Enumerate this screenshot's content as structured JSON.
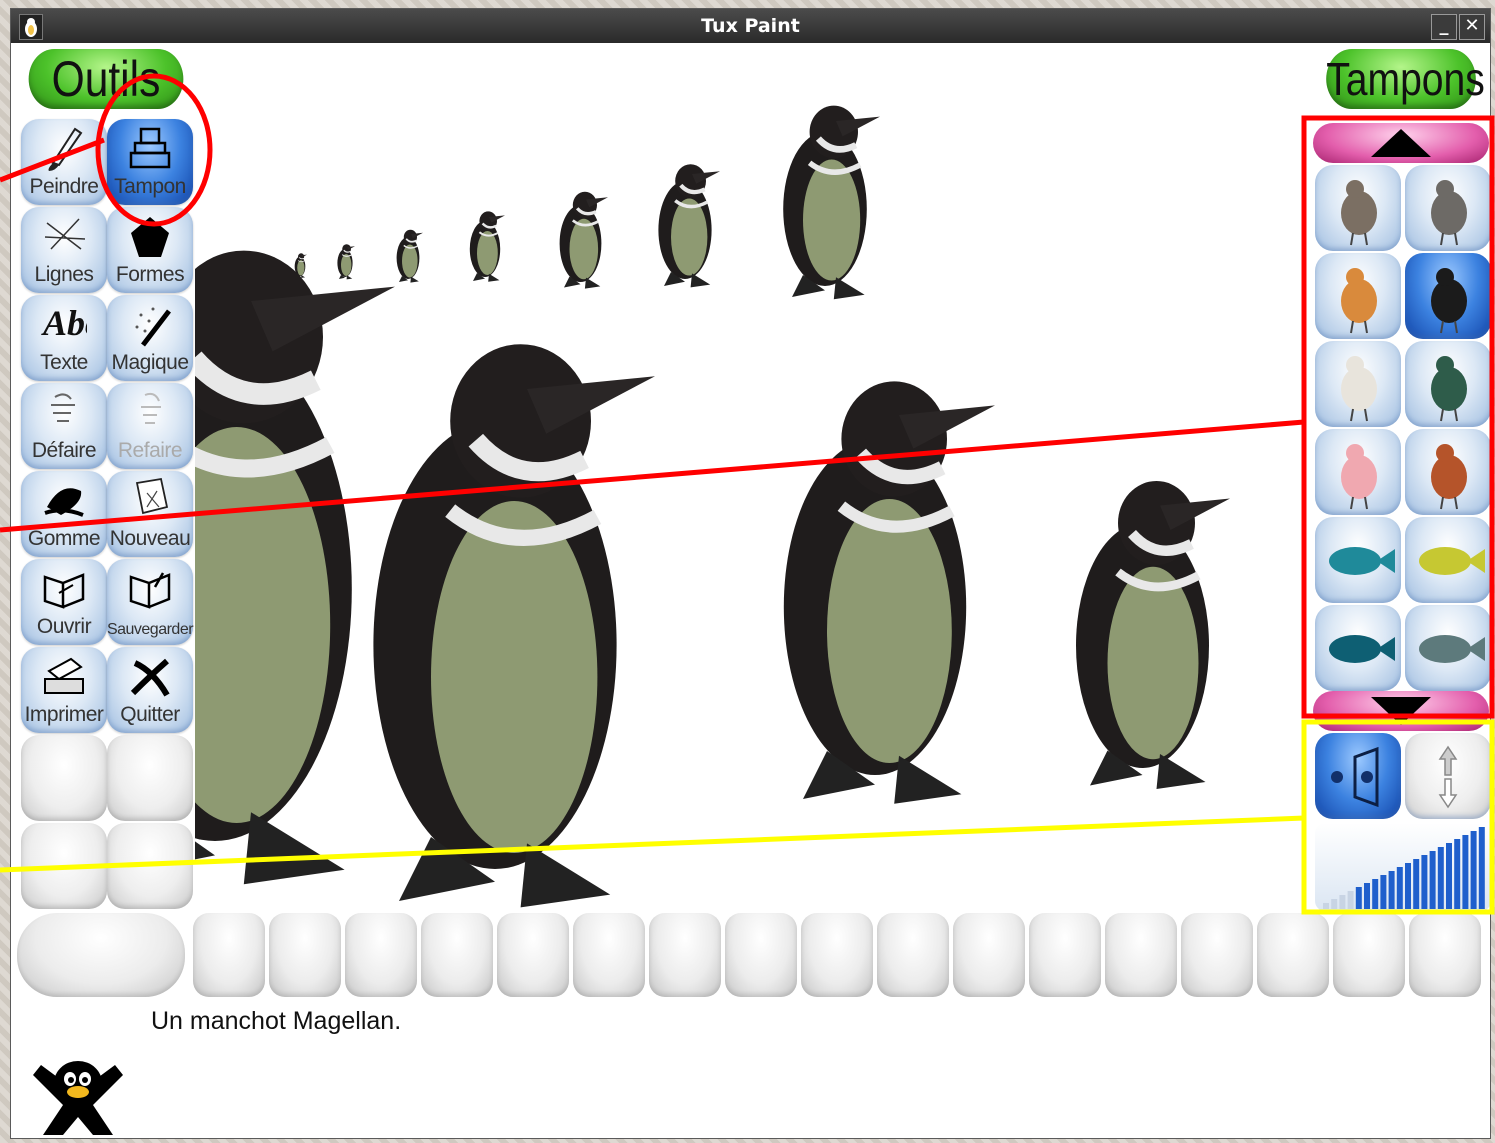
{
  "window": {
    "title": "Tux Paint",
    "minimize_symbol": "_",
    "close_symbol": "✕"
  },
  "tools_panel": {
    "header": "Outils",
    "items": [
      {
        "label": "Peindre",
        "icon": "brush-icon",
        "selected": false,
        "disabled": false
      },
      {
        "label": "Tampon",
        "icon": "stamp-icon",
        "selected": true,
        "disabled": false
      },
      {
        "label": "Lignes",
        "icon": "lines-icon",
        "selected": false,
        "disabled": false
      },
      {
        "label": "Formes",
        "icon": "shapes-icon",
        "selected": false,
        "disabled": false
      },
      {
        "label": "Texte",
        "icon": "text-icon",
        "icon_text": "Abc",
        "selected": false,
        "disabled": false
      },
      {
        "label": "Magique",
        "icon": "magic-wand-icon",
        "selected": false,
        "disabled": false
      },
      {
        "label": "Défaire",
        "icon": "undo-icon",
        "selected": false,
        "disabled": false
      },
      {
        "label": "Refaire",
        "icon": "redo-icon",
        "selected": false,
        "disabled": true
      },
      {
        "label": "Gomme",
        "icon": "eraser-icon",
        "selected": false,
        "disabled": false
      },
      {
        "label": "Nouveau",
        "icon": "new-page-icon",
        "selected": false,
        "disabled": false
      },
      {
        "label": "Ouvrir",
        "icon": "open-book-icon",
        "selected": false,
        "disabled": false
      },
      {
        "label": "Sauvegarder",
        "icon": "save-book-icon",
        "selected": false,
        "disabled": false
      },
      {
        "label": "Imprimer",
        "icon": "printer-icon",
        "selected": false,
        "disabled": false
      },
      {
        "label": "Quitter",
        "icon": "quit-icon",
        "selected": false,
        "disabled": false
      }
    ]
  },
  "stamps_panel": {
    "header": "Tampons",
    "scroll_up_icon": "triangle-up-icon",
    "scroll_down_icon": "triangle-down-icon",
    "items": [
      {
        "name": "guinea-fowl"
      },
      {
        "name": "crowned-crane"
      },
      {
        "name": "hen"
      },
      {
        "name": "magellanic-penguin",
        "selected": true
      },
      {
        "name": "ostrich"
      },
      {
        "name": "peacock"
      },
      {
        "name": "flamingo"
      },
      {
        "name": "rooster"
      },
      {
        "name": "blue-fish"
      },
      {
        "name": "striped-tropical-fish"
      },
      {
        "name": "clownfish"
      },
      {
        "name": "grey-fish"
      }
    ],
    "controls": {
      "mirror_icon": "mirror-flip-icon",
      "flip_icon": "flip-vertical-icon",
      "size_icon": "size-slider-icon"
    }
  },
  "status": {
    "message": "Un manchot Magellan.",
    "mascot_icon": "tux-penguin-icon"
  },
  "colors": {
    "accent_select": "#3c82e0",
    "header_green": "#4cc22a",
    "scroll_pink": "#e35eac",
    "annotation_red": "#ff0000",
    "annotation_yellow": "#ffff00"
  }
}
